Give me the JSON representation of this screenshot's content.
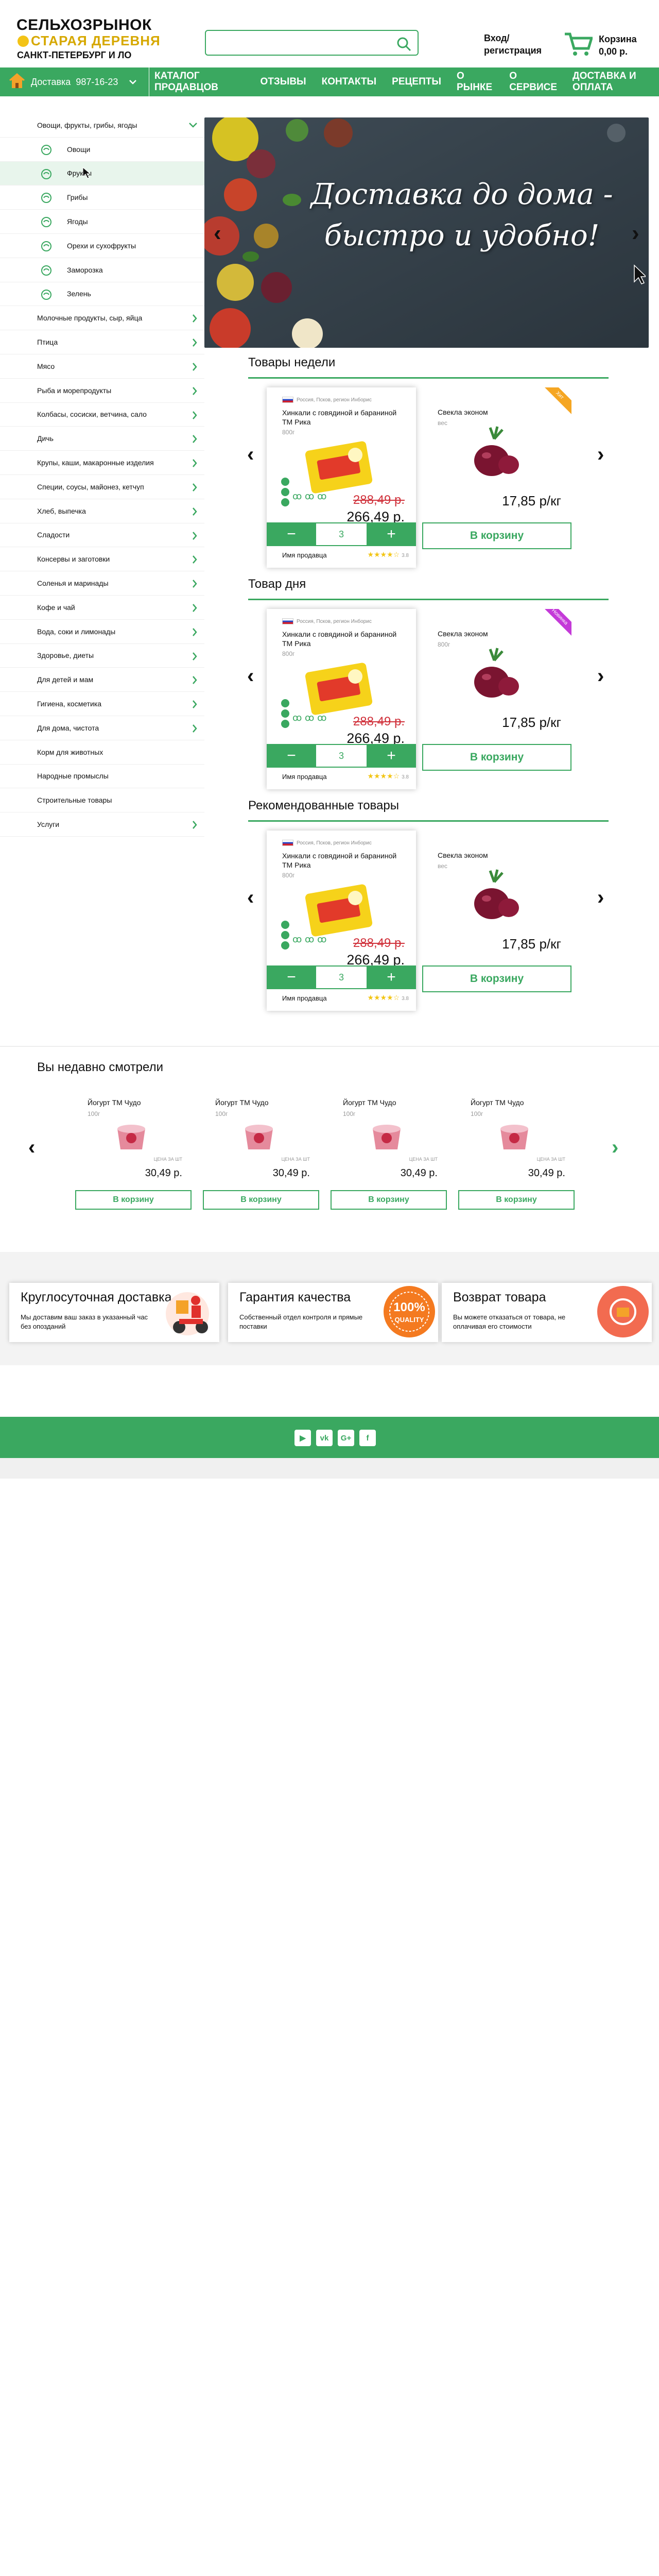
{
  "header": {
    "logo_line1": "СЕЛЬХОЗРЫНОК",
    "logo_line2": "СТАРАЯ ДЕРЕВНЯ",
    "region": "САНКТ-ПЕТЕРБУРГ И ЛО",
    "search_placeholder": "",
    "login": "Вход/ регистрация",
    "cart_label": "Корзина",
    "cart_total": "0,00 р."
  },
  "nav": {
    "delivery_label": "Доставка",
    "phone": "987-16-23",
    "items": [
      "КАТАЛОГ ПРОДАВЦОВ",
      "ОТЗЫВЫ",
      "КОНТАКТЫ",
      "РЕЦЕПТЫ",
      "О РЫНКЕ",
      "О СЕРВИСЕ",
      "ДОСТАВКА И ОПЛАТА"
    ]
  },
  "sidebar": {
    "top": "Овощи, фрукты, грибы, ягоды",
    "sub": [
      "Овощи",
      "Фрукты",
      "Грибы",
      "Ягоды",
      "Орехи и сухофрукты",
      "Заморозка",
      "Зелень"
    ],
    "categories": [
      "Молочные продукты, сыр, яйца",
      "Птица",
      "Мясо",
      "Рыба и морепродукты",
      "Колбасы, сосиски, ветчина, сало",
      "Дичь",
      "Крупы, каши, макаронные изделия",
      "Специи, соусы, майонез, кетчуп",
      "Хлеб, выпечка",
      "Сладости",
      "Консервы и заготовки",
      "Соленья и маринады",
      "Кофе и чай",
      "Вода, соки и лимонады",
      "Здоровье, диеты",
      "Для детей и мам",
      "Гигиена, косметика",
      "Для дома, чистота",
      "Корм для животных",
      "Народные промыслы",
      "Строительные товары",
      "Услуги"
    ],
    "no_chevron": [
      "Корм для животных",
      "Народные промыслы",
      "Строительные товары"
    ]
  },
  "banner": {
    "text": "Доставка до дома - быстро и удобно!"
  },
  "sections": [
    {
      "title": "Товары недели",
      "origin": "Россия, Псков, регион Инборис",
      "ribbon": "Хит",
      "ribbon_color": "#f5a623",
      "product": "Хинкали с говядиной и бараниной ТМ Рика",
      "weight": "800г",
      "old_price": "288,49 р.",
      "price": "266,49 р.",
      "qty": "3",
      "seller": "Имя продавца",
      "rating": "3.8",
      "product2": "Свекла эконом",
      "weight2": "вес",
      "price2": "17,85 р/кг",
      "cart_btn": "В корзину"
    },
    {
      "title": "Товар дня",
      "origin": "Россия, Псков, регион Инборис",
      "ribbon": "Новинка",
      "ribbon_color": "#c43ad8",
      "product": "Хинкали с говядиной и бараниной ТМ Рика",
      "weight": "800г",
      "old_price": "288,49 р.",
      "price": "266,49 р.",
      "qty": "3",
      "seller": "Имя продавца",
      "rating": "3.8",
      "product2": "Свекла эконом",
      "weight2": "800г",
      "price2": "17,85 р/кг",
      "cart_btn": "В корзину"
    },
    {
      "title": "Рекомендованные товары",
      "origin": "Россия, Псков, регион Инборис",
      "ribbon": "",
      "ribbon_color": "",
      "product": "Хинкали с говядиной и бараниной ТМ Рика",
      "weight": "800г",
      "old_price": "288,49 р.",
      "price": "266,49 р.",
      "qty": "3",
      "seller": "Имя продавца",
      "rating": "3.8",
      "product2": "Свекла эконом",
      "weight2": "вес",
      "price2": "17,85 р/кг",
      "cart_btn": "В корзину"
    }
  ],
  "recent": {
    "title": "Вы недавно смотрели",
    "items": [
      {
        "name": "Йогурт ТМ Чудо",
        "weight": "100г",
        "price_label": "ЦЕНА ЗА ШТ",
        "price": "30,49 р.",
        "button": "В корзину"
      },
      {
        "name": "Йогурт ТМ Чудо",
        "weight": "100г",
        "price_label": "ЦЕНА ЗА ШТ",
        "price": "30,49 р.",
        "button": "В корзину"
      },
      {
        "name": "Йогурт ТМ Чудо",
        "weight": "100г",
        "price_label": "ЦЕНА ЗА ШТ",
        "price": "30,49 р.",
        "button": "В корзину"
      },
      {
        "name": "Йогурт ТМ Чудо",
        "weight": "100г",
        "price_label": "ЦЕНА ЗА ШТ",
        "price": "30,49 р.",
        "button": "В корзину"
      }
    ]
  },
  "features": [
    {
      "title": "Круглосуточная доставка",
      "desc": "Мы доставим ваш заказ в указанный час без опозданий"
    },
    {
      "title": "Гарантия качества",
      "desc": "Собственный отдел контроля и прямые поставки",
      "badge_top": "100%",
      "badge_bottom": "QUALITY"
    },
    {
      "title": "Возврат товара",
      "desc": "Вы можете отказаться от товара, не оплачивая его стоимости"
    }
  ],
  "social": [
    "youtube-icon",
    "vk-icon",
    "googleplus-icon",
    "facebook-icon"
  ],
  "social_labels": [
    "▶",
    "vk",
    "G+",
    "f"
  ],
  "colors": {
    "primary": "#3aa860",
    "price_old": "#d0303a",
    "logo_yellow": "#d6a800"
  }
}
